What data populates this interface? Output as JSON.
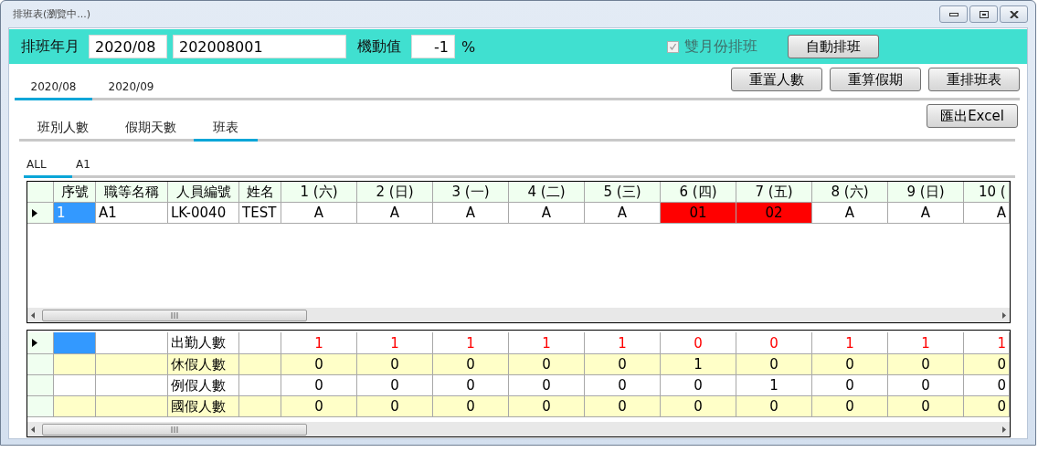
{
  "window": {
    "title": "排班表(瀏覽中...)"
  },
  "toolbar": {
    "month_label": "排班年月",
    "month_value": "2020/08",
    "code_value": "202008001",
    "flex_label": "機動值",
    "flex_value": "-1",
    "unit": "%",
    "bimonthly": {
      "label": "雙月份排班",
      "checked": true,
      "disabled": true
    },
    "auto_button": "自動排班"
  },
  "month_tabs": [
    {
      "label": "2020/08",
      "selected": true
    },
    {
      "label": "2020/09",
      "selected": false
    }
  ],
  "action_buttons": [
    "重置人數",
    "重算假期",
    "重排班表"
  ],
  "view_tabs": [
    {
      "label": "班別人數",
      "selected": false
    },
    {
      "label": "假期天數",
      "selected": false
    },
    {
      "label": "班表",
      "selected": true
    }
  ],
  "export_button": "匯出Excel",
  "group_tabs": [
    {
      "label": "ALL",
      "selected": true
    },
    {
      "label": "A1",
      "selected": false
    }
  ],
  "schedule": {
    "columns": [
      "序號",
      "職等名稱",
      "人員編號",
      "姓名",
      "1 (六)",
      "2 (日)",
      "3 (一)",
      "4 (二)",
      "5 (三)",
      "6 (四)",
      "7 (五)",
      "8 (六)",
      "9 (日)",
      "10 ("
    ],
    "rows": [
      {
        "current": true,
        "selected": true,
        "cells": [
          "1",
          "A1",
          "LK-0040",
          "TEST"
        ],
        "days": [
          {
            "text": "A"
          },
          {
            "text": "A"
          },
          {
            "text": "A"
          },
          {
            "text": "A"
          },
          {
            "text": "A"
          },
          {
            "text": "01",
            "color": "#ff0000"
          },
          {
            "text": "02",
            "color": "#ff0000"
          },
          {
            "text": "A"
          },
          {
            "text": "A"
          },
          {
            "text": "A"
          }
        ]
      }
    ]
  },
  "summary": {
    "rows": [
      {
        "current": true,
        "selected": true,
        "label": "出勤人數",
        "color": "#ff0000",
        "values": [
          "1",
          "1",
          "1",
          "1",
          "1",
          "0",
          "0",
          "1",
          "1",
          "1"
        ]
      },
      {
        "current": false,
        "selected": false,
        "label": "休假人數",
        "color": "#000000",
        "values": [
          "0",
          "0",
          "0",
          "0",
          "0",
          "1",
          "0",
          "0",
          "0",
          "0"
        ]
      },
      {
        "current": false,
        "selected": false,
        "label": "例假人數",
        "color": "#000000",
        "values": [
          "0",
          "0",
          "0",
          "0",
          "0",
          "0",
          "1",
          "0",
          "0",
          "0"
        ]
      },
      {
        "current": false,
        "selected": false,
        "label": "國假人數",
        "color": "#000000",
        "values": [
          "0",
          "0",
          "0",
          "0",
          "0",
          "0",
          "0",
          "0",
          "0",
          "0"
        ]
      }
    ]
  }
}
